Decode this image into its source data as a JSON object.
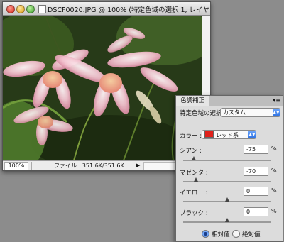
{
  "document": {
    "title": "DSCF0020.JPG @ 100% (特定色域の選択 1, レイヤ...",
    "zoom": "100%",
    "file_info": "ファイル : 351.6K/351.6K",
    "status_arrow": "▶"
  },
  "panel": {
    "tab": "色調補正",
    "menu_glyph": "▾≡",
    "heading": "特定色域の選択",
    "preset_value": "カスタム",
    "color_label": "カラー :",
    "color_value": "レッド系",
    "color_swatch": "#e0201a",
    "sliders": [
      {
        "label": "シアン :",
        "value": "-75",
        "unit": "%"
      },
      {
        "label": "マゼンタ :",
        "value": "-70",
        "unit": "%"
      },
      {
        "label": "イエロー :",
        "value": "0",
        "unit": "%"
      },
      {
        "label": "ブラック :",
        "value": "0",
        "unit": "%"
      }
    ],
    "method_relative": "相対値",
    "method_absolute": "絶対値",
    "method_selected": "relative"
  }
}
